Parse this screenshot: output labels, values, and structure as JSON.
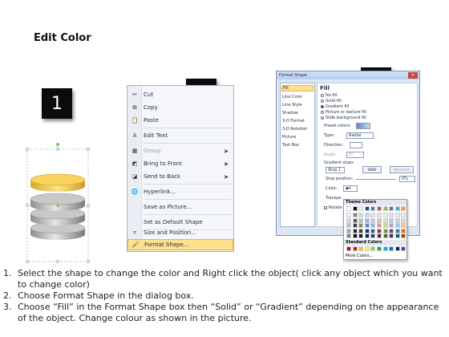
{
  "page": {
    "title": "Edit Color",
    "steps": [
      "1",
      "2",
      "3"
    ]
  },
  "context_menu": {
    "items": [
      {
        "label": "Cut",
        "icon": "scissors-icon",
        "enabled": true
      },
      {
        "label": "Copy",
        "icon": "copy-icon",
        "enabled": true
      },
      {
        "label": "Paste",
        "icon": "paste-icon",
        "enabled": true
      },
      {
        "label": "Edit Text",
        "icon": "edit-text-icon",
        "enabled": true
      },
      {
        "label": "Group",
        "icon": "group-icon",
        "enabled": false,
        "submenu": true
      },
      {
        "label": "Bring to Front",
        "icon": "bring-to-front-icon",
        "enabled": true,
        "submenu": true
      },
      {
        "label": "Send to Back",
        "icon": "send-to-back-icon",
        "enabled": true,
        "submenu": true
      },
      {
        "label": "Hyperlink...",
        "icon": "hyperlink-icon",
        "enabled": true
      },
      {
        "label": "Save as Picture...",
        "icon": "",
        "enabled": true
      },
      {
        "label": "Set as Default Shape",
        "icon": "",
        "enabled": true
      },
      {
        "label": "Size and Position...",
        "icon": "size-position-icon",
        "enabled": true
      },
      {
        "label": "Format Shape...",
        "icon": "format-shape-icon",
        "enabled": true,
        "highlighted": true
      }
    ]
  },
  "format_dialog": {
    "title": "Format Shape",
    "categories": [
      "Fill",
      "Line Color",
      "Line Style",
      "Shadow",
      "3-D Format",
      "3-D Rotation",
      "Picture",
      "Text Box"
    ],
    "selected_category": "Fill",
    "section_heading": "Fill",
    "fill_options": [
      "No fill",
      "Solid fill",
      "Gradient fill",
      "Picture or texture fill",
      "Slide background fill"
    ],
    "selected_fill": "Gradient fill",
    "preset_colors_label": "Preset colors:",
    "type_label": "Type:",
    "type_value": "Radial",
    "direction_label": "Direction:",
    "angle_label": "Angle:",
    "angle_value": "0°",
    "gradient_stops_label": "Gradient stops",
    "stop_value": "Stop 1",
    "add_button": "Add",
    "remove_button": "Remove",
    "stop_position_label": "Stop position:",
    "stop_position_value": "0%",
    "color_label": "Color:",
    "transparency_label": "Transpa",
    "rotate_label": "Rotate"
  },
  "color_picker": {
    "theme_colors_heading": "Theme Colors",
    "standard_colors_heading": "Standard Colors",
    "more_colors": "More Colors...",
    "theme_row": [
      "#ffffff",
      "#000000",
      "#eeece1",
      "#1f497d",
      "#4f81bd",
      "#c0504d",
      "#9bbb59",
      "#8064a2",
      "#4bacc6",
      "#f79646"
    ],
    "tint_rows": [
      [
        "#f2f2f2",
        "#7f7f7f",
        "#ddd9c3",
        "#c6d9f0",
        "#dbe5f1",
        "#f2dcdb",
        "#ebf1dd",
        "#e5e0ec",
        "#dbeef3",
        "#fdeada"
      ],
      [
        "#d8d8d8",
        "#595959",
        "#c4bd97",
        "#8db3e2",
        "#b8cce4",
        "#e5b9b7",
        "#d7e3bc",
        "#ccc1d9",
        "#b7dde8",
        "#fbd5b5"
      ],
      [
        "#bfbfbf",
        "#3f3f3f",
        "#938953",
        "#548dd4",
        "#95b3d7",
        "#d99694",
        "#c3d69b",
        "#b2a2c7",
        "#92cddc",
        "#fac08f"
      ],
      [
        "#a5a5a5",
        "#262626",
        "#494429",
        "#17365d",
        "#366092",
        "#953734",
        "#76923c",
        "#5f497a",
        "#31859b",
        "#e36c09"
      ],
      [
        "#7f7f7f",
        "#0c0c0c",
        "#1d1b10",
        "#0f243e",
        "#244061",
        "#632423",
        "#4f6128",
        "#3f3151",
        "#205867",
        "#974806"
      ]
    ],
    "standard_row": [
      "#c00000",
      "#ff0000",
      "#ffc000",
      "#ffff00",
      "#92d050",
      "#00b050",
      "#00b0f0",
      "#0070c0",
      "#002060",
      "#7030a0"
    ]
  },
  "instructions": [
    {
      "num": "1.",
      "text": "Select the shape to change the color and Right click the object( click any object which you want to change color)"
    },
    {
      "num": "2.",
      "text": "Choose Format Shape in the dialog box."
    },
    {
      "num": "3.",
      "text": "Choose “Fill” in the Format Shape box then “Solid” or “Gradient” depending on the appearance of the object. Change colour as shown in the picture."
    }
  ],
  "colors": {
    "disc_top": "#f5c94a",
    "disc_gray": "#a8a8a8",
    "highlight": "#fbe08e"
  }
}
